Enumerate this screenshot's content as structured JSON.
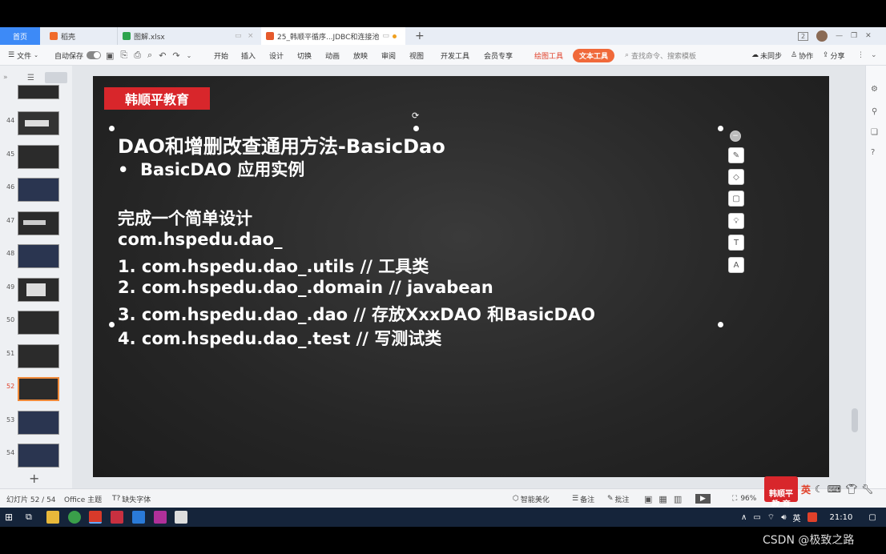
{
  "tabs": [
    {
      "label": "首页",
      "active": true
    },
    {
      "label": "稻壳"
    },
    {
      "label": "图解.xlsx"
    },
    {
      "label": "25_韩顺平循序...JDBC和连接池"
    }
  ],
  "new_tab": "+",
  "window_badge": "2",
  "toolbar": {
    "file": "文件",
    "autosave": "自动保存",
    "menus": [
      "开始",
      "插入",
      "设计",
      "切换",
      "动画",
      "放映",
      "审阅",
      "视图",
      "开发工具",
      "会员专享"
    ],
    "draw_tools": "绘图工具",
    "text_tools": "文本工具",
    "search_placeholder": "查找命令、搜索模板",
    "unsynced": "未同步",
    "collab": "协作",
    "share": "分享"
  },
  "thumbnails": [
    {
      "num": "44"
    },
    {
      "num": "45"
    },
    {
      "num": "46"
    },
    {
      "num": "47"
    },
    {
      "num": "48"
    },
    {
      "num": "49"
    },
    {
      "num": "50"
    },
    {
      "num": "51"
    },
    {
      "num": "52",
      "selected": true
    },
    {
      "num": "53"
    },
    {
      "num": "54"
    }
  ],
  "add_slide": "+",
  "slide": {
    "brand": "韩顺平教育",
    "title": "DAO和增删改查通用方法-BasicDao",
    "bullet": "BasicDAO 应用实例",
    "lines": [
      "完成一个简单设计",
      "com.hspedu.dao_",
      "1.  com.hspedu.dao_.utils // 工具类",
      "2.  com.hspedu.dao_.domain // javabean",
      "3.  com.hspedu.dao_.dao // 存放XxxDAO 和BasicDAO",
      "4.  com.hspedu.dao_.test // 写测试类"
    ]
  },
  "statusbar": {
    "slide_count": "幻灯片 52 / 54",
    "theme": "Office 主题",
    "missing_font": "缺失字体",
    "beautify": "智能美化",
    "notes": "备注",
    "comments": "批注",
    "zoom": "96%"
  },
  "watermark_logo": "韩顺平\n教 育",
  "ime": "英",
  "taskbar": {
    "ime": "英",
    "time": "21:10"
  },
  "csdn": "CSDN @极致之路",
  "colors": {
    "accent": "#e0412a",
    "text_tools": "#f0693a",
    "brand_red": "#d8262b"
  }
}
